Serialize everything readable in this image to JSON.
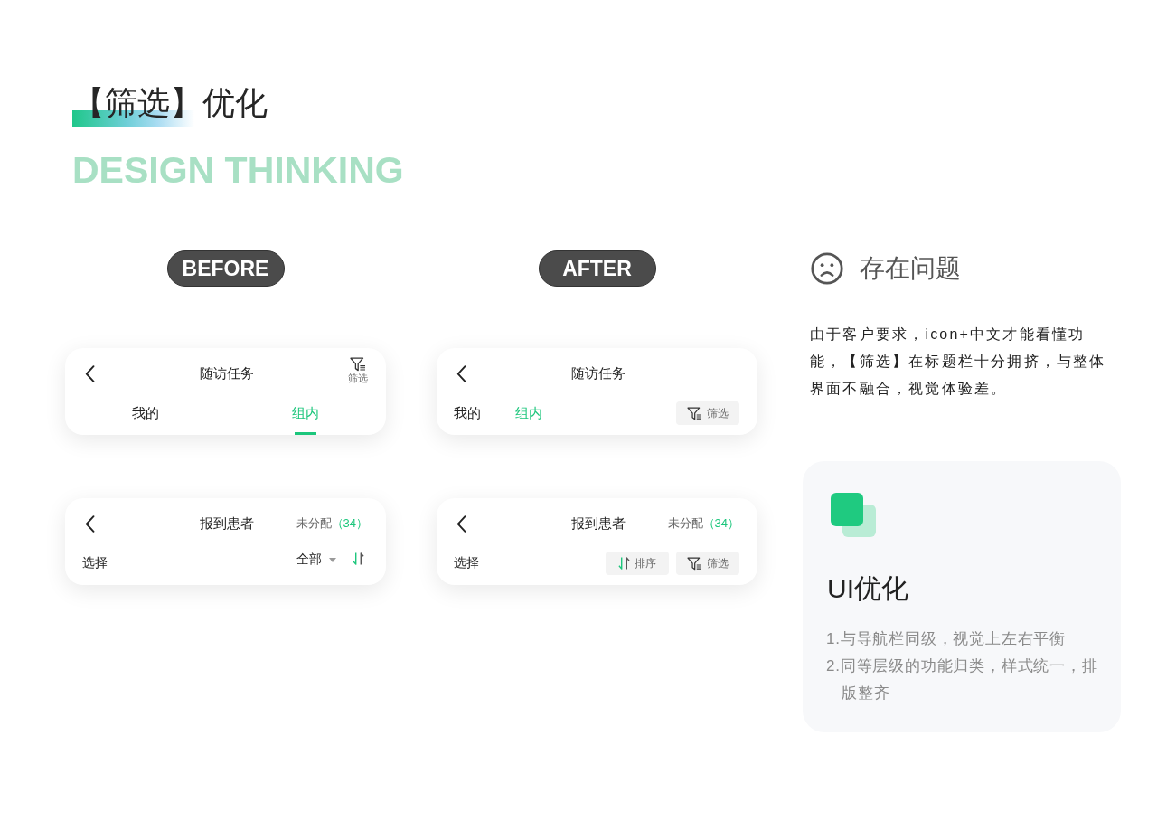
{
  "title": "【筛选】优化",
  "subtitle": "DESIGN THINKING",
  "comparisons": [
    {
      "label": "BEFORE",
      "screens": [
        {
          "kind": "tabs",
          "title": "随访任务",
          "header_action": {
            "kind": "filter",
            "label": "筛选"
          },
          "tabs": [
            {
              "label": "我的",
              "selected": false
            },
            {
              "label": "组内",
              "selected": true
            }
          ]
        },
        {
          "kind": "list",
          "title": "报到患者",
          "status": {
            "label": "未分配",
            "count": "（34）"
          },
          "row_label": "选择",
          "dropdown": {
            "label": "全部"
          },
          "tools": [
            {
              "kind": "sort"
            }
          ]
        }
      ]
    },
    {
      "label": "AFTER",
      "screens": [
        {
          "kind": "tabs",
          "title": "随访任务",
          "tabs": [
            {
              "label": "我的",
              "selected": false
            },
            {
              "label": "组内",
              "selected": true
            }
          ],
          "tools": [
            {
              "kind": "filter",
              "label": "筛选"
            }
          ]
        },
        {
          "kind": "list",
          "title": "报到患者",
          "status": {
            "label": "未分配",
            "count": "（34）"
          },
          "row_label": "选择",
          "tools": [
            {
              "kind": "sort",
              "label": "排序"
            },
            {
              "kind": "filter",
              "label": "筛选"
            }
          ]
        }
      ]
    }
  ],
  "issue": {
    "heading": "存在问题",
    "text": "由于客户要求，icon+中文才能看懂功能，【筛选】在标题栏十分拥挤，与整体界面不融合，视觉体验差。"
  },
  "solution": {
    "title": "UI优化",
    "points": [
      "1.与导航栏同级，视觉上左右平衡",
      "2.同等层级的功能归类，样式统一，排版整齐"
    ]
  }
}
